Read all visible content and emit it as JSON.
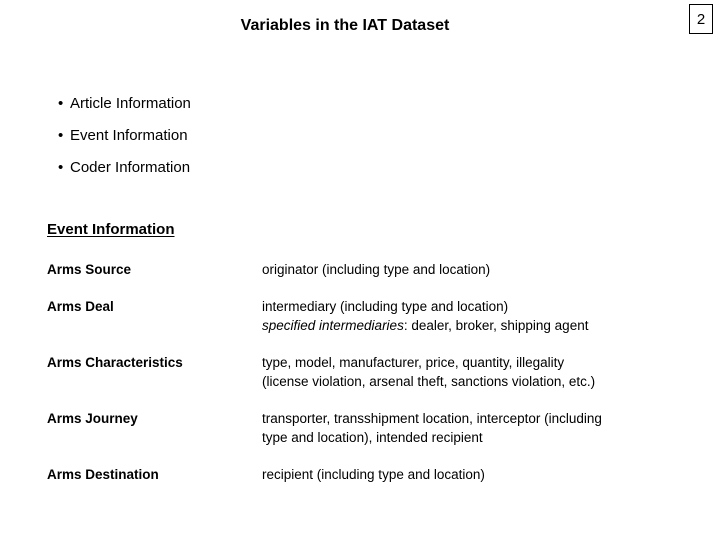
{
  "page": {
    "number": "2"
  },
  "title": "Variables in the IAT Dataset",
  "bullets": [
    {
      "marker": "•",
      "label": "Article Information"
    },
    {
      "marker": "•",
      "label": "Event Information"
    },
    {
      "marker": "•",
      "label": "Coder Information"
    }
  ],
  "section": {
    "heading": "Event Information"
  },
  "variables": [
    {
      "term": "Arms Source",
      "line1": "originator (including type and location)",
      "line2_italic": "",
      "line2_rest": ""
    },
    {
      "term": "Arms Deal",
      "line1": "intermediary (including type and location)",
      "line2_italic": "specified intermediaries",
      "line2_rest": ": dealer, broker, shipping agent"
    },
    {
      "term": "Arms Characteristics",
      "line1": "type, model, manufacturer, price, quantity, illegality",
      "line2_italic": "",
      "line2_rest": "(license violation, arsenal theft, sanctions violation, etc.)"
    },
    {
      "term": "Arms Journey",
      "line1": "transporter, transshipment location, interceptor (including",
      "line2_italic": "",
      "line2_rest": "type and location), intended recipient"
    },
    {
      "term": "Arms Destination",
      "line1": "recipient (including type and location)",
      "line2_italic": "",
      "line2_rest": ""
    }
  ],
  "colors": {
    "background": "#ffffff",
    "text": "#000000",
    "border": "#000000"
  }
}
